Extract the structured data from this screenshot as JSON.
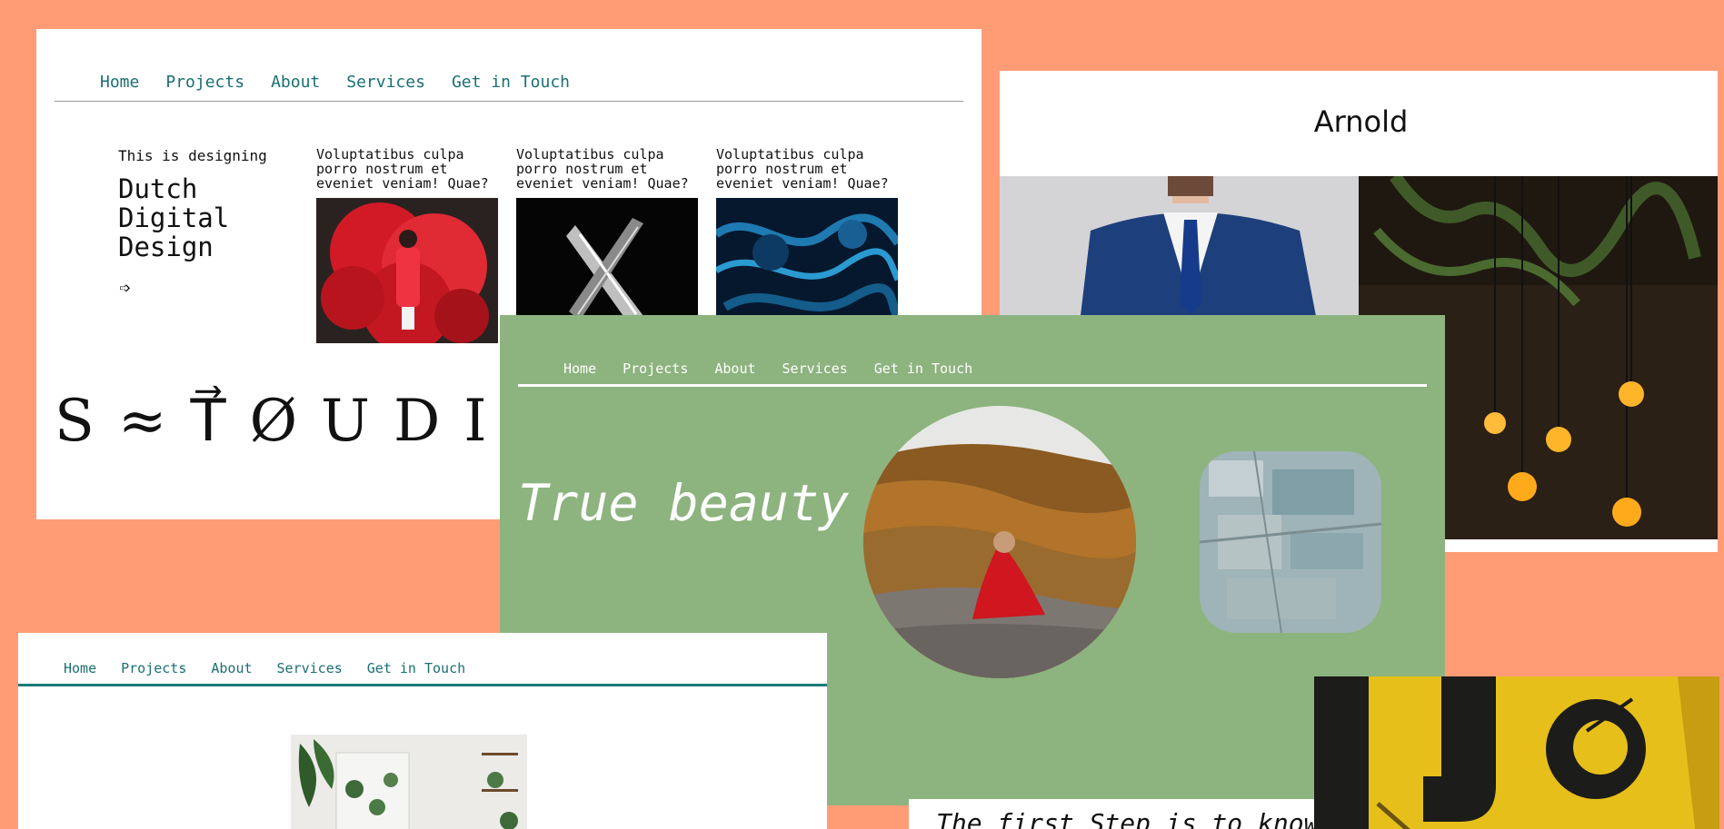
{
  "nav_items": [
    "Home",
    "Projects",
    "About",
    "Services",
    "Get in Touch"
  ],
  "studio": {
    "intro": "This is designing",
    "heading_lines": [
      "Dutch",
      "Digital",
      "Design"
    ],
    "arrow": "➩",
    "columns": [
      {
        "text": "Voluptatibus culpa porro nostrum et eveniet veniam! Quae?",
        "image": "red-smoke-hoodie-photo"
      },
      {
        "text": "Voluptatibus culpa porro nostrum et eveniet veniam! Quae?",
        "image": "silver-x-sculpture-photo"
      },
      {
        "text": "Voluptatibus culpa porro nostrum et eveniet veniam! Quae?",
        "image": "blue-ink-swirl-photo"
      }
    ],
    "logo": "S≈T⃗ØUDIO"
  },
  "arnold": {
    "title": "Arnold",
    "photos": [
      "man-in-blue-suit-photo",
      "hanging-lightbulbs-photo"
    ]
  },
  "beauty": {
    "headline": "True beauty",
    "photos": [
      "woman-red-dress-mountain-photo",
      "map-collage-photo"
    ]
  },
  "plant": {
    "photo": "plant-shelf-photo"
  },
  "first_step": {
    "text": "The first Step is to know"
  },
  "yellow": {
    "photo": "yellow-graffiti-photo"
  },
  "colors": {
    "background": "#ff9c76",
    "nav_teal": "#1a6f73",
    "green_panel": "#8db37f",
    "white": "#ffffff"
  }
}
